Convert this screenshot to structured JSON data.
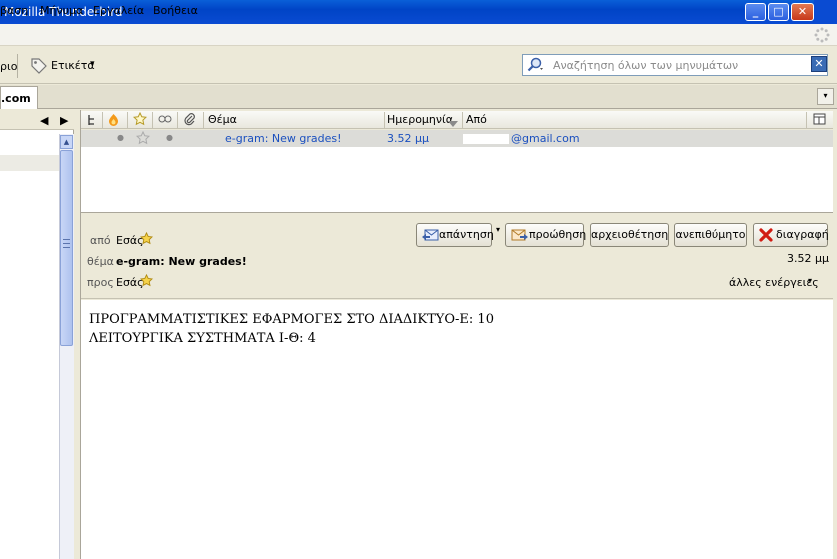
{
  "window": {
    "title": "Mozilla Thunderbird"
  },
  "window_buttons": {
    "minimize": "_",
    "maximize": "□",
    "close": "✕"
  },
  "menubar": {
    "items": [
      "βαση",
      "Μήνυμα",
      "Εργαλεία",
      "Βοήθεια"
    ]
  },
  "toolbar": {
    "left_label": "ριο",
    "tag_label": "Ετικέτα",
    "tag_arrow": "▾"
  },
  "search": {
    "placeholder": "Αναζήτηση όλων των μηνυμάτων",
    "clear": "✕"
  },
  "tabs": {
    "active_label": ".com",
    "overflow": "▾"
  },
  "folder_nav": {
    "prev": "◀",
    "next": "▶"
  },
  "list": {
    "columns": {
      "subject": "Θέμα",
      "date": "Ημερομηνία",
      "from": "Από"
    },
    "messages": [
      {
        "subject": "e-gram: New grades!",
        "date": "3.52 μμ",
        "from": "@gmail.com"
      }
    ]
  },
  "header": {
    "from_label": "από",
    "from_value": "Εσάς",
    "subject_label": "θέμα",
    "subject_value": "e-gram: New grades!",
    "to_label": "προς",
    "to_value": "Εσάς",
    "time": "3.52 μμ",
    "more_actions": "άλλες ενέργειες",
    "buttons": {
      "reply": "απάντηση",
      "forward": "προώθηση",
      "archive": "αρχειοθέτηση",
      "junk": "ανεπιθύμητο",
      "delete": "διαγραφή"
    }
  },
  "body": {
    "lines": [
      "ΠΡΟΓΡΑΜΜΑΤΙΣΤΙΚΕΣ ΕΦΑΡΜΟΓΕΣ ΣΤΟ ΔΙΑΔΙΚΤΥΟ-Ε: 10",
      "ΛΕΙΤΟΥΡΓΙΚΑ ΣΥΣΤΗΜΑΤΑ Ι-Θ: 4"
    ]
  },
  "colors": {
    "titlebar": "#0a4bd2",
    "link_blue": "#1a4fbf",
    "chrome": "#ece9d8"
  }
}
